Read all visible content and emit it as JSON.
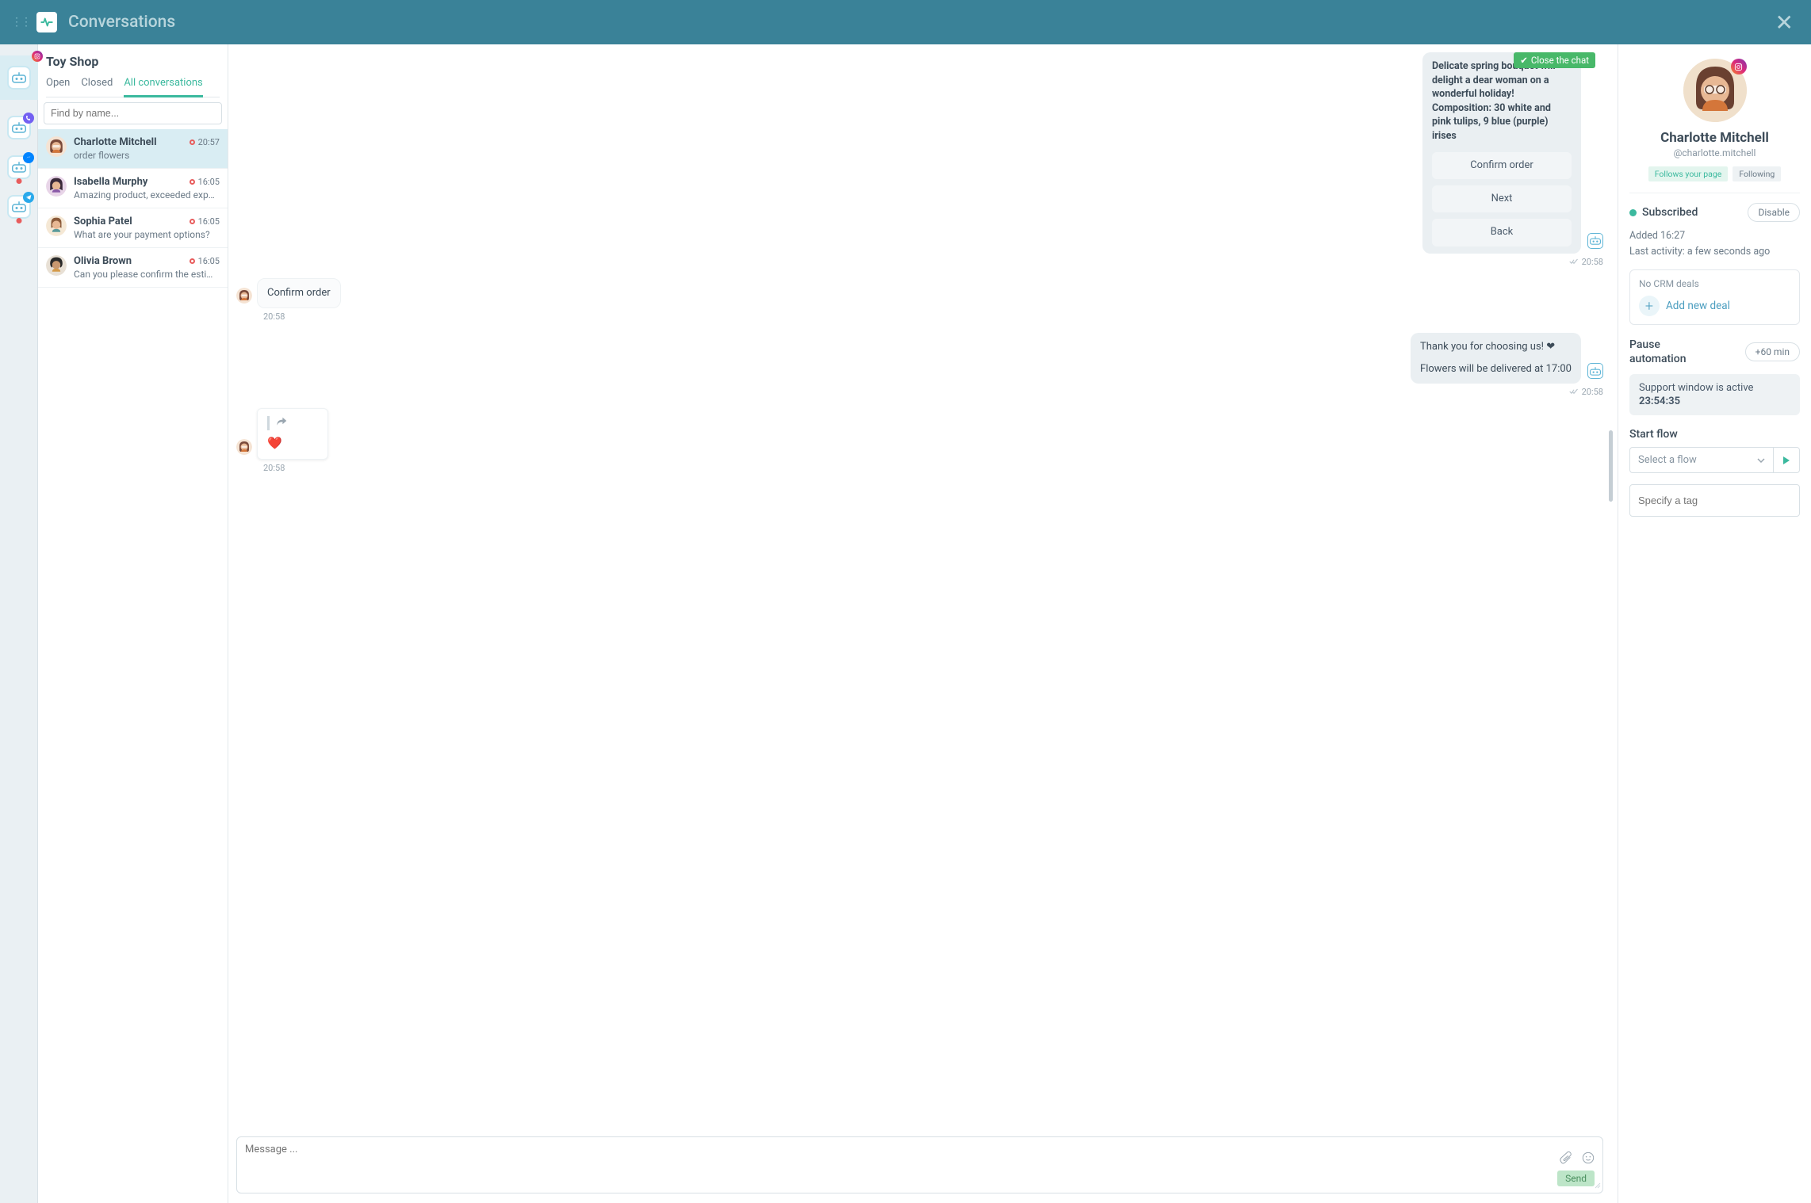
{
  "header": {
    "title": "Conversations"
  },
  "rail": {
    "channels": [
      {
        "id": "instagram",
        "color": "#e1306c"
      },
      {
        "id": "viber",
        "color": "#7360f2"
      },
      {
        "id": "messenger",
        "color": "#0084ff"
      },
      {
        "id": "telegram",
        "color": "#29a9eb"
      }
    ]
  },
  "list": {
    "title": "Toy Shop",
    "tabs": {
      "open": "Open",
      "closed": "Closed",
      "all": "All conversations"
    },
    "active_tab": "all",
    "search_placeholder": "Find by name...",
    "items": [
      {
        "name": "Charlotte Mitchell",
        "preview": "order flowers",
        "time": "20:57",
        "unread": true,
        "selected": true
      },
      {
        "name": "Isabella Murphy",
        "preview": "Amazing product, exceeded expe...",
        "time": "16:05",
        "unread": true,
        "selected": false
      },
      {
        "name": "Sophia Patel",
        "preview": "What are your payment options?",
        "time": "16:05",
        "unread": true,
        "selected": false
      },
      {
        "name": "Olivia Brown",
        "preview": "Can you please confirm the estim...",
        "time": "16:05",
        "unread": true,
        "selected": false
      }
    ]
  },
  "chat": {
    "close_label": "Close the chat",
    "intro_text": "Delicate spring bouquet will delight a dear woman on a wonderful holiday! Composition: 30 white and pink tulips, 9 blue (purple) irises",
    "actions": {
      "confirm": "Confirm order",
      "next": "Next",
      "back": "Back"
    },
    "intro_time": "20:58",
    "user_reply": "Confirm order",
    "user_reply_time": "20:58",
    "thanks": "Thank you for choosing us! ❤",
    "delivery": "Flowers will be delivered at 17:00",
    "thanks_time": "20:58",
    "react_emoji": "❤️",
    "react_time": "20:58",
    "composer_placeholder": "Message ...",
    "send_label": "Send"
  },
  "details": {
    "name": "Charlotte Mitchell",
    "handle": "@charlotte.mitchell",
    "badges": {
      "follows": "Follows your page",
      "following": "Following"
    },
    "subscribed_label": "Subscribed",
    "disable_label": "Disable",
    "added": "Added 16:27",
    "last_activity": "Last activity: a few seconds ago",
    "no_deals": "No CRM deals",
    "add_deal": "Add new deal",
    "pause_label": "Pause automation",
    "pause_btn": "+60 min",
    "support_active": "Support window is active",
    "support_timer": "23:54:35",
    "start_flow_label": "Start flow",
    "flow_placeholder": "Select a flow",
    "tag_placeholder": "Specify a tag"
  }
}
